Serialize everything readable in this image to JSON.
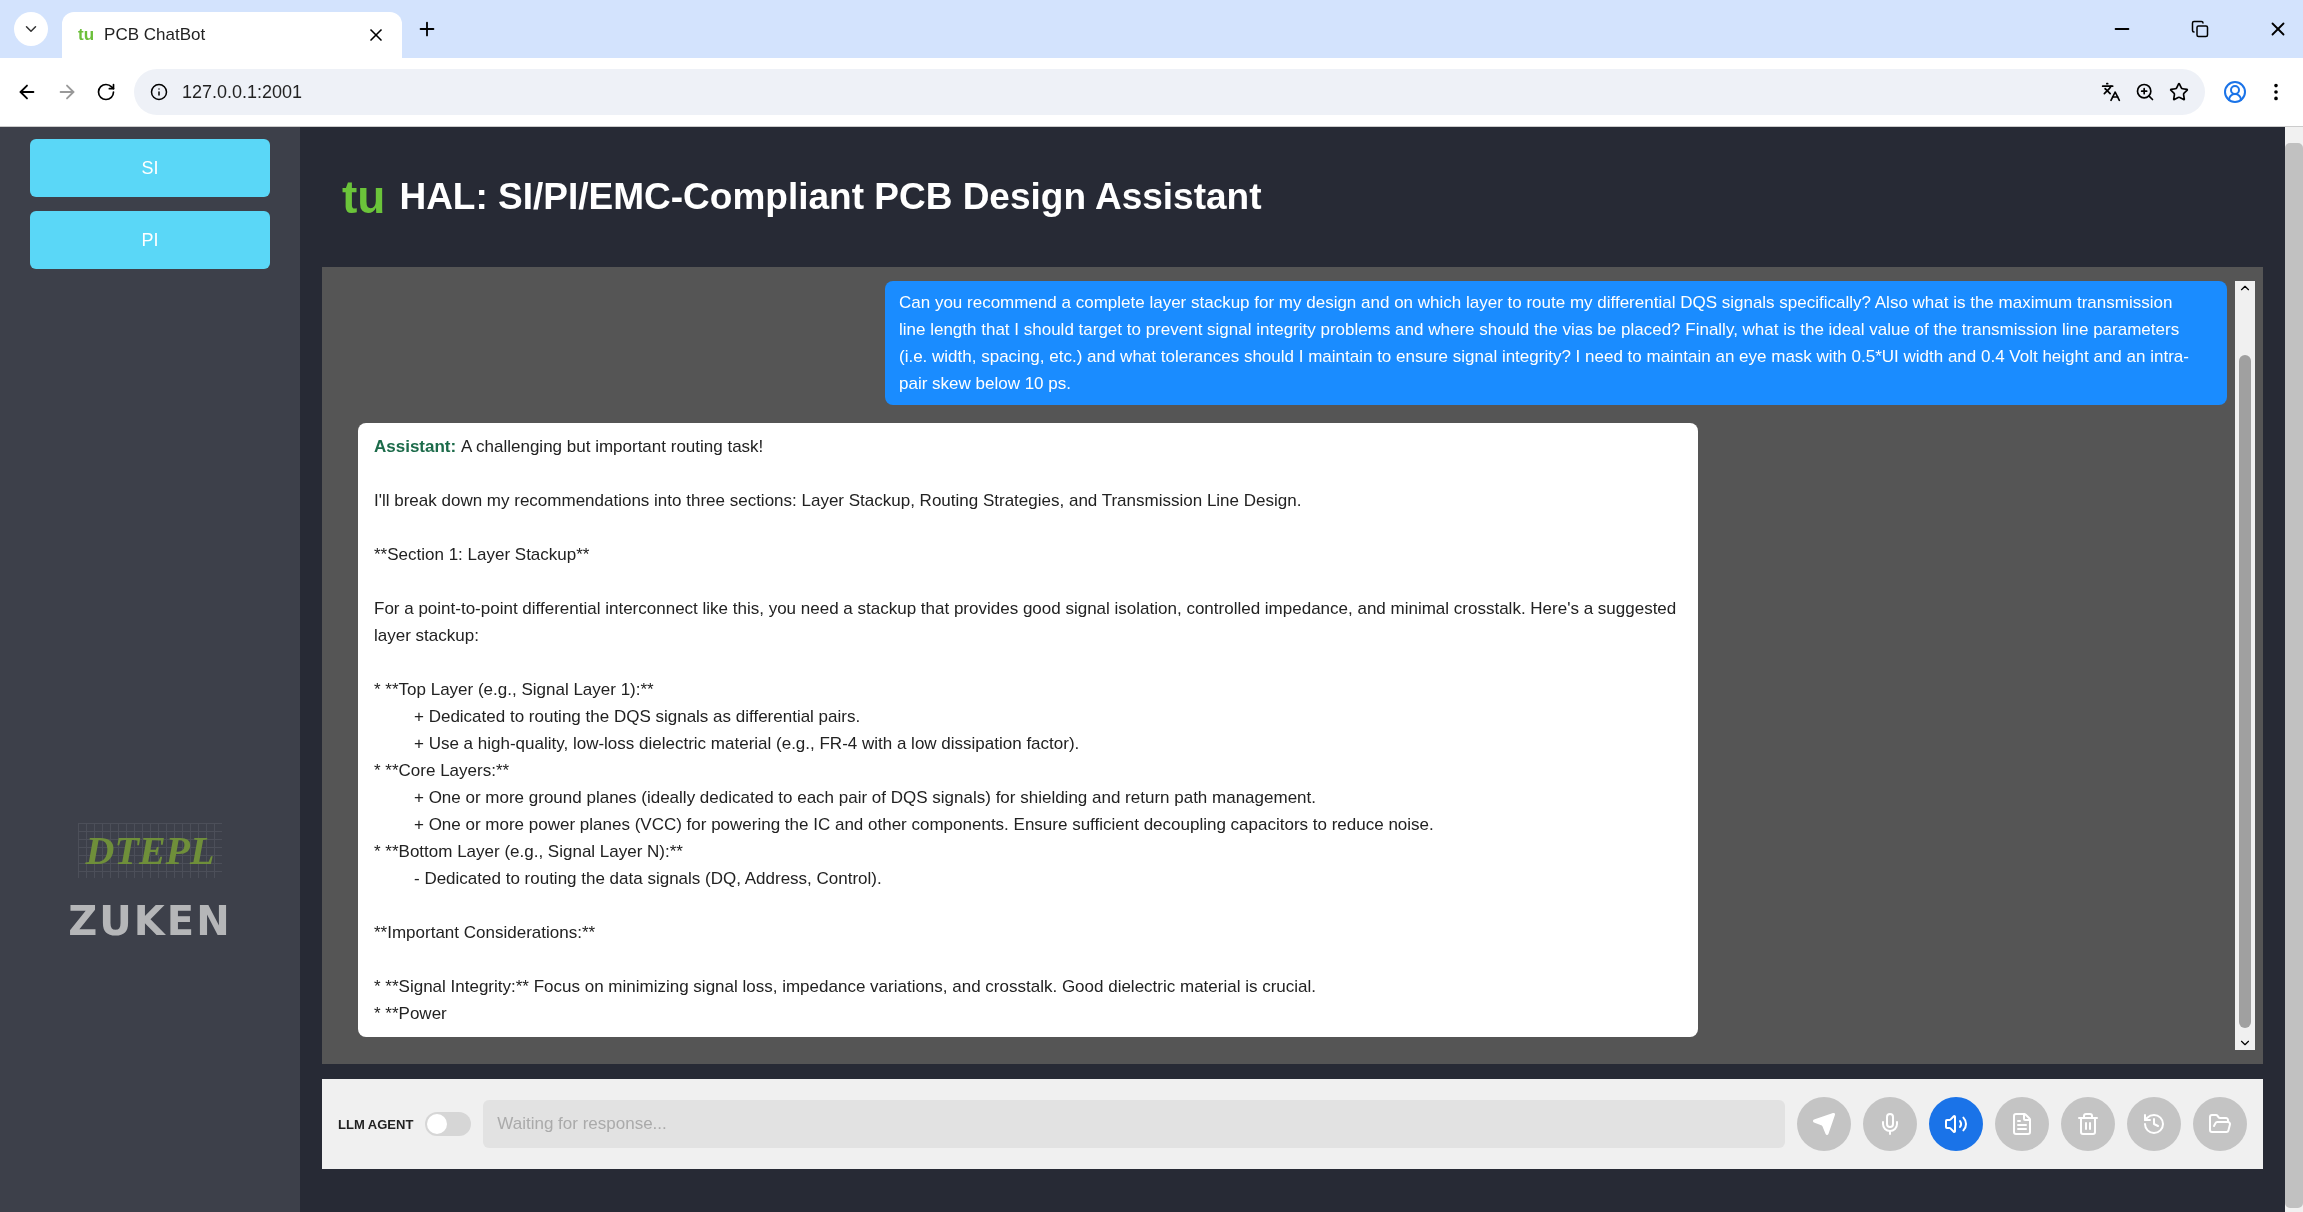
{
  "browser": {
    "favicon": "tu",
    "tab_title": "PCB ChatBot",
    "url": "127.0.0.1:2001"
  },
  "sidebar": {
    "buttons": [
      {
        "label": "SI"
      },
      {
        "label": "PI"
      }
    ],
    "logos": [
      "DTEPL",
      "ZUKEN"
    ]
  },
  "header": {
    "logo": "tu",
    "title": "HAL: SI/PI/EMC-Compliant PCB Design Assistant"
  },
  "chat": {
    "messages": [
      {
        "kind": "user",
        "paragraphs": [
          {
            "kind": "text",
            "text": "Can you recommend a complete layer stackup for my design and on which layer to route my differential DQS signals specifically? Also what is the maximum transmission line length that I should target to prevent signal integrity problems and where should the vias be placed? Finally, what is the ideal value of the transmission line parameters (i.e. width, spacing, etc.) and what tolerances should I maintain to ensure signal integrity? I need to maintain an eye mask with 0.5*UI width and 0.4 Volt height and an intra-pair skew below 10 ps."
          }
        ]
      },
      {
        "kind": "assistant",
        "speaker": "Assistant:",
        "paragraphs": [
          {
            "kind": "text",
            "text": "A challenging but important routing task!"
          },
          {
            "kind": "text",
            "text": "I'll break down my recommendations into three sections: Layer Stackup, Routing Strategies, and Transmission Line Design."
          },
          {
            "kind": "text",
            "text": "**Section 1: Layer Stackup**"
          },
          {
            "kind": "text",
            "text": "For a point-to-point differential interconnect like this, you need a stackup that provides good signal isolation, controlled impedance, and minimal crosstalk. Here's a suggested layer stackup:"
          },
          {
            "kind": "list",
            "items": [
              {
                "text": "* **Top Layer (e.g., Signal Layer 1):**",
                "children": [
                  {
                    "text": "+ Dedicated to routing the DQS signals as differential pairs."
                  },
                  {
                    "text": "+ Use a high-quality, low-loss dielectric material (e.g., FR-4 with a low dissipation factor)."
                  }
                ]
              },
              {
                "text": "* **Core Layers:**",
                "children": [
                  {
                    "text": "+ One or more ground planes (ideally dedicated to each pair of DQS signals) for shielding and return path management."
                  },
                  {
                    "text": "+ One or more power planes (VCC) for powering the IC and other components.  Ensure sufficient decoupling capacitors to reduce noise."
                  }
                ]
              },
              {
                "text": "* **Bottom Layer (e.g., Signal Layer N):**",
                "children": [
                  {
                    "text": "- Dedicated to routing the data signals (DQ, Address, Control)."
                  }
                ]
              }
            ]
          },
          {
            "kind": "text",
            "text": "**Important Considerations:**"
          },
          {
            "kind": "list",
            "items": [
              {
                "text": "* **Signal Integrity:** Focus on minimizing signal loss, impedance variations, and crosstalk.  Good dielectric material is crucial."
              },
              {
                "text": "* **Power"
              }
            ]
          }
        ]
      }
    ]
  },
  "composer": {
    "agent_label": "LLM AGENT",
    "agent_on": false,
    "placeholder": "Waiting for response...",
    "actions": [
      {
        "kind": "send",
        "active": false
      },
      {
        "kind": "mic",
        "active": false
      },
      {
        "kind": "speaker",
        "active": true
      },
      {
        "kind": "file",
        "active": false
      },
      {
        "kind": "trash",
        "active": false
      },
      {
        "kind": "history",
        "active": false
      },
      {
        "kind": "folder",
        "active": false
      }
    ]
  }
}
